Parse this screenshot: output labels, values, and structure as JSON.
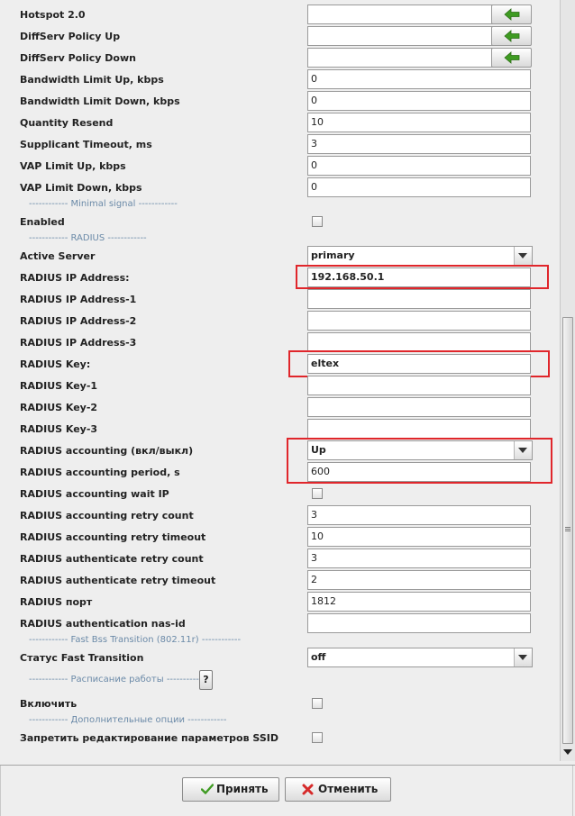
{
  "fields": {
    "hotspot": {
      "label": "Hotspot 2.0",
      "value": ""
    },
    "diffserv_up": {
      "label": "DiffServ Policy Up",
      "value": ""
    },
    "diffserv_down": {
      "label": "DiffServ Policy Down",
      "value": ""
    },
    "bw_up": {
      "label": "Bandwidth Limit Up, kbps",
      "value": "0"
    },
    "bw_down": {
      "label": "Bandwidth Limit Down, kbps",
      "value": "0"
    },
    "qty_resend": {
      "label": "Quantity Resend",
      "value": "10"
    },
    "supp_timeout": {
      "label": "Supplicant Timeout, ms",
      "value": "3"
    },
    "vap_up": {
      "label": "VAP Limit Up, kbps",
      "value": "0"
    },
    "vap_down": {
      "label": "VAP Limit Down, kbps",
      "value": "0"
    },
    "enabled": {
      "label": "Enabled",
      "checked": false
    },
    "active_server": {
      "label": "Active Server",
      "value": "primary"
    },
    "radius_ip": {
      "label": "RADIUS IP Address:",
      "value": "192.168.50.1"
    },
    "radius_ip1": {
      "label": "RADIUS IP Address-1",
      "value": ""
    },
    "radius_ip2": {
      "label": "RADIUS IP Address-2",
      "value": ""
    },
    "radius_ip3": {
      "label": "RADIUS IP Address-3",
      "value": ""
    },
    "radius_key": {
      "label": "RADIUS Key:",
      "value": "eltex"
    },
    "radius_key1": {
      "label": "RADIUS Key-1",
      "value": ""
    },
    "radius_key2": {
      "label": "RADIUS Key-2",
      "value": ""
    },
    "radius_key3": {
      "label": "RADIUS Key-3",
      "value": ""
    },
    "acct": {
      "label": "RADIUS accounting (вкл/выкл)",
      "value": "Up"
    },
    "acct_period": {
      "label": "RADIUS accounting period, s",
      "value": "600"
    },
    "acct_wait_ip": {
      "label": "RADIUS accounting wait IP",
      "checked": false
    },
    "acct_retry_count": {
      "label": "RADIUS accounting retry count",
      "value": "3"
    },
    "acct_retry_timeout": {
      "label": "RADIUS accounting retry timeout",
      "value": "10"
    },
    "auth_retry_count": {
      "label": "RADIUS authenticate retry count",
      "value": "3"
    },
    "auth_retry_timeout": {
      "label": "RADIUS authenticate retry timeout",
      "value": "2"
    },
    "radius_port": {
      "label": "RADIUS порт",
      "value": "1812"
    },
    "nas_id": {
      "label": "RADIUS authentication nas-id",
      "value": ""
    },
    "fast_transition": {
      "label": "Статус Fast Transition",
      "value": "off"
    },
    "schedule_enable": {
      "label": "Включить",
      "checked": false
    },
    "forbid_ssid_edit": {
      "label": "Запретить редактирование параметров SSID",
      "checked": false
    }
  },
  "sections": {
    "minimal_signal": "------------ Minimal signal ------------",
    "radius": "------------ RADIUS ------------",
    "fast_bss": "------------ Fast Bss Transition (802.11r) ------------",
    "schedule": "------------ Расписание работы ------------",
    "extra": "------------ Дополнительные опции ------------"
  },
  "help_button": "?",
  "buttons": {
    "accept": "Принять",
    "cancel": "Отменить"
  },
  "colors": {
    "highlight": "#e0262b",
    "section_text": "#6b8aa8",
    "arrow_green": "#3f9b22"
  },
  "icons": {
    "apply": "green-arrow-left-icon",
    "accept": "check-icon",
    "cancel": "red-x-icon"
  }
}
